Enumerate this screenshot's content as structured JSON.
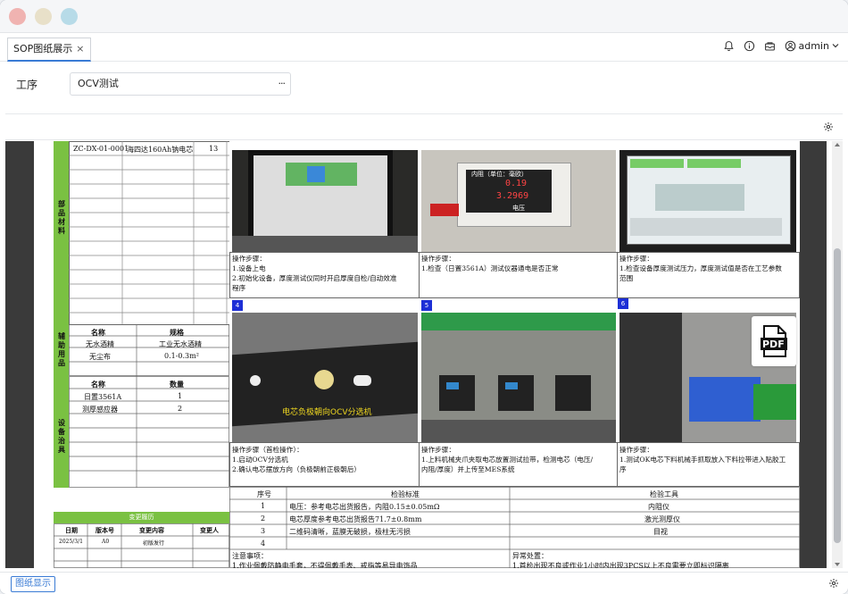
{
  "window": {
    "traffic_colors": [
      "#f0b3b1",
      "#e8e0c9",
      "#b7dbe8"
    ]
  },
  "tabbar": {
    "tab_label": "SOP图纸展示",
    "tab_close": "×"
  },
  "topbar": {
    "user": "admin",
    "icons": [
      "bell-icon",
      "info-icon",
      "inbox-icon",
      "user-icon",
      "chevron-down-icon"
    ]
  },
  "form": {
    "process_label": "工序",
    "process_value": "OCV测试",
    "more_button": "···"
  },
  "document": {
    "material_row": {
      "code": "ZC-DX-01-0001",
      "name": "海四达160Ah钠电芯",
      "qty": "13"
    },
    "section_parts": "部品材料",
    "section_aux": "辅助用品",
    "section_tools": "设备治具",
    "aux_header": {
      "name": "名称",
      "spec": "规格"
    },
    "aux_rows": [
      {
        "name": "无水酒精",
        "spec": "工业无水酒精"
      },
      {
        "name": "无尘布",
        "spec": "0.1-0.3m²"
      }
    ],
    "tool_header": {
      "name": "名称",
      "qty": "数量"
    },
    "tool_rows": [
      {
        "name": "日置3561A",
        "qty": "1"
      },
      {
        "name": "测厚感应器",
        "qty": "2"
      }
    ],
    "change_record": {
      "title": "变更履历",
      "headers": [
        "日期",
        "版本号",
        "变更内容",
        "变更人"
      ],
      "row": [
        "2025/3/1",
        "A0",
        "初版发行",
        ""
      ]
    },
    "photo_labels": {
      "meter_title": "内阻（单位：毫欧）",
      "meter_value": "0.19",
      "meter_value2": "3.2969",
      "meter_caption": "电压",
      "ocv_caption": "电芯负极朝向OCV分选机",
      "num4": "4",
      "num5": "5",
      "num6": "6"
    },
    "steps": [
      {
        "title": "操作步骤：",
        "lines": [
          "1.设备上电",
          "2.初始化设备，厚度测试仪同时开启厚度自检/自动效准",
          "程序"
        ]
      },
      {
        "title": "操作步骤：",
        "lines": [
          "1.检查（日置3561A）测试仪器通电是否正常"
        ]
      },
      {
        "title": "操作步骤：",
        "lines": [
          "1.检查设备厚度测试压力，厚度测试值是否在工艺参数",
          "范围"
        ]
      },
      {
        "title": "操作步骤（首检操作）：",
        "lines": [
          "1.启动OCV分选机",
          "2.确认电芯摆放方向（负极朝前正极朝后）"
        ]
      },
      {
        "title": "操作步骤：",
        "lines": [
          "1.上料机械夹爪夹取电芯放置测试拉带，检测电芯（电压/",
          "内阻/厚度）并上传至MES系统"
        ]
      },
      {
        "title": "操作步骤：",
        "lines": [
          "1.测试OK电芯下料机械手抓取放入下料拉带进入贴胶工",
          "序"
        ]
      }
    ],
    "inspection": {
      "headers": [
        "序号",
        "检验标准",
        "检验工具"
      ],
      "rows": [
        {
          "no": "1",
          "std": "电压：参考电芯出货报告，内阻0.15±0.05mΩ",
          "tool": "内阻仪"
        },
        {
          "no": "2",
          "std": "电芯厚度参考电芯出货报告71.7±0.8mm",
          "tool": "激光测厚仪"
        },
        {
          "no": "3",
          "std": "二维码清晰，蓝膜无破损，极柱无污损",
          "tool": "目视"
        },
        {
          "no": "4",
          "std": "",
          "tool": ""
        }
      ],
      "notes_label": "注意事项：",
      "notes_line": "1.作业佩戴防静电手套，不得佩戴手表、戒指等易导电饰品",
      "abnormal_label": "异常处置：",
      "abnormal_line": "1.首检出现不良或作业1小时内出现3PCS以上不良需要立即标识隔离"
    },
    "pdf_label": "PDF"
  },
  "bottombar": {
    "tab_label": "图纸显示"
  },
  "colors": {
    "accent": "#3a7bd5",
    "green": "#7ac142",
    "badge_blue": "#1d2fd6"
  }
}
